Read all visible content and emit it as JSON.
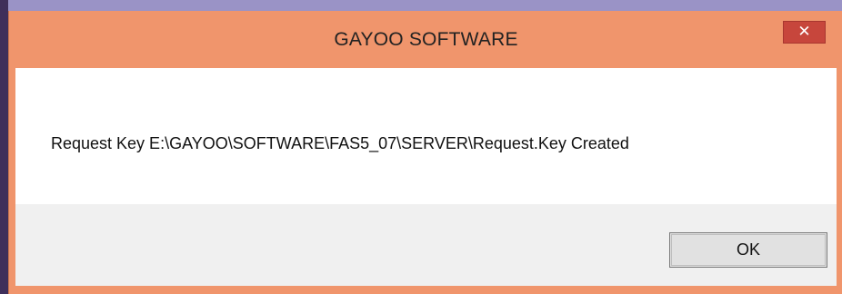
{
  "dialog": {
    "title": "GAYOO SOFTWARE",
    "message": "Request Key E:\\GAYOO\\SOFTWARE\\FAS5_07\\SERVER\\Request.Key Created",
    "close_glyph": "✕",
    "ok_label": "OK"
  },
  "colors": {
    "desktop": "#3b2d52",
    "title_bar": "#f0956c",
    "close_button": "#c7463c",
    "button_area": "#f0f0f0"
  },
  "icons": {
    "close": "close-icon"
  }
}
